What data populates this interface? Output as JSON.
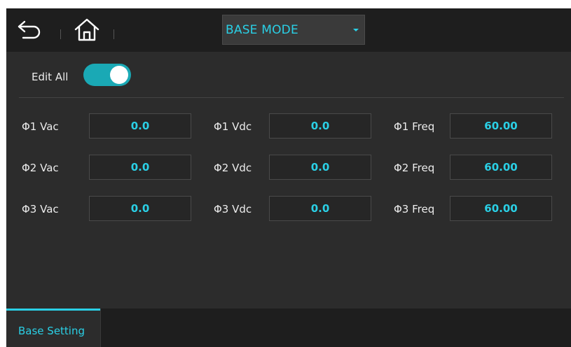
{
  "header": {
    "back_icon": "back-arrow-icon",
    "home_icon": "home-icon",
    "mode_select": {
      "value": "BASE MODE",
      "caret_icon": "caret-down-icon"
    }
  },
  "edit_all": {
    "label": "Edit All",
    "state": "on"
  },
  "params": {
    "rows": [
      {
        "vac_label": "Φ1 Vac",
        "vac_value": "0.0",
        "vdc_label": "Φ1 Vdc",
        "vdc_value": "0.0",
        "freq_label": "Φ1 Freq",
        "freq_value": "60.00"
      },
      {
        "vac_label": "Φ2 Vac",
        "vac_value": "0.0",
        "vdc_label": "Φ2 Vdc",
        "vdc_value": "0.0",
        "freq_label": "Φ2 Freq",
        "freq_value": "60.00"
      },
      {
        "vac_label": "Φ3 Vac",
        "vac_value": "0.0",
        "vdc_label": "Φ3 Vdc",
        "vdc_value": "0.0",
        "freq_label": "Φ3 Freq",
        "freq_value": "60.00"
      }
    ]
  },
  "bottom_tabs": [
    {
      "label": "Base Setting",
      "active": true
    }
  ],
  "colors": {
    "accent": "#2ad0e6",
    "toggle_on": "#1aa9b5",
    "panel_bg": "#2c2c2c",
    "bar_bg": "#1e1e1e"
  }
}
